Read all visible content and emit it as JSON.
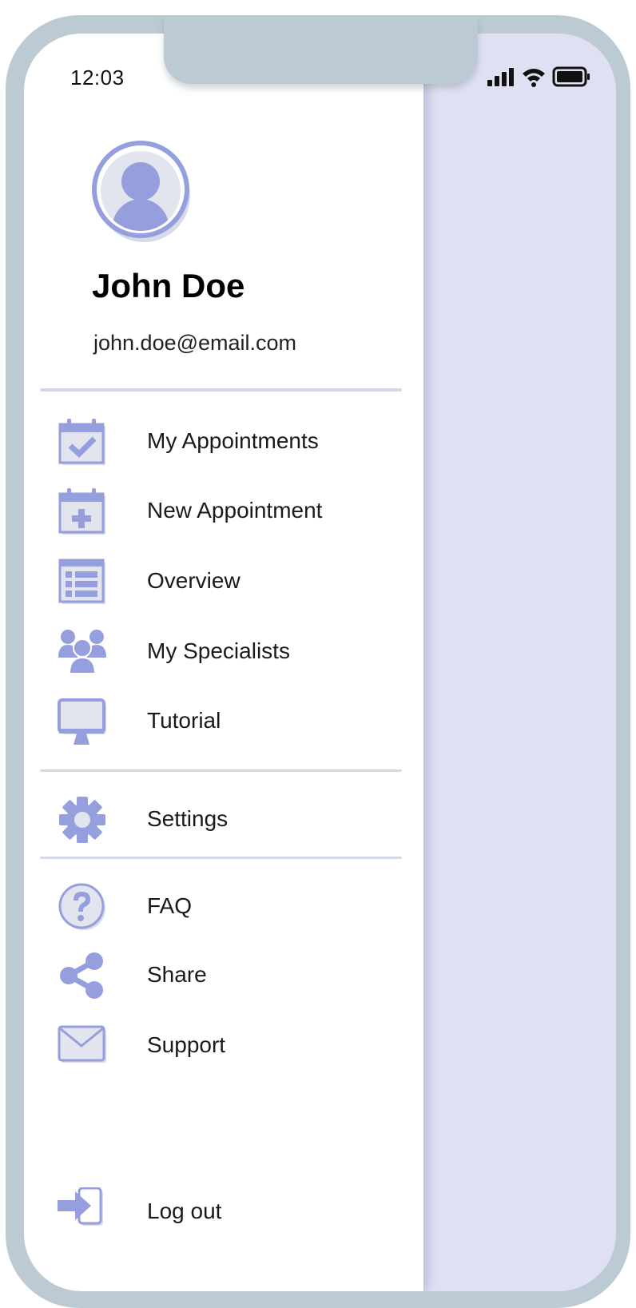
{
  "status_bar": {
    "time": "12:03",
    "icons": [
      "signal-icon",
      "wifi-icon",
      "battery-icon"
    ]
  },
  "profile": {
    "name": "John Doe",
    "email": "john.doe@email.com",
    "avatar_icon": "user-avatar-icon"
  },
  "menu": {
    "primary": [
      {
        "label": "My Appointments",
        "icon": "calendar-check-icon"
      },
      {
        "label": "New Appointment",
        "icon": "calendar-plus-icon"
      },
      {
        "label": "Overview",
        "icon": "list-icon"
      },
      {
        "label": "My Specialists",
        "icon": "people-icon"
      },
      {
        "label": "Tutorial",
        "icon": "monitor-icon"
      }
    ],
    "settings": {
      "label": "Settings",
      "icon": "gear-icon"
    },
    "secondary": [
      {
        "label": "FAQ",
        "icon": "question-icon"
      },
      {
        "label": "Share",
        "icon": "share-icon"
      },
      {
        "label": "Support",
        "icon": "mail-icon"
      }
    ],
    "logout": {
      "label": "Log out",
      "icon": "logout-icon"
    }
  },
  "colors": {
    "accent": "#969fdd",
    "accent_light": "#e2e5ee",
    "frame": "#bccad4",
    "overlay": "#dfe1f3",
    "divider": "#d2d8e6"
  }
}
